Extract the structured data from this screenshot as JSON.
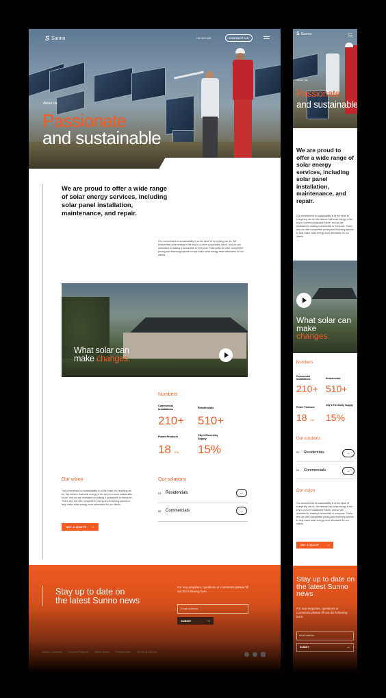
{
  "brand": {
    "name": "Sunno"
  },
  "header": {
    "phone": "+32 423 423",
    "contact_label": "CONTACT US"
  },
  "hero": {
    "eyebrow": "About Us",
    "title_line1": "Passionate",
    "title_line2": "and sustainable"
  },
  "intro": {
    "lead": "We are proud to offer a wide range of solar energy services, including solar panel installation, maintenance, and repair.",
    "body": "Our commitment to sustainability is at the heart of everything we do. We believe that solar energy is the key to a more sustainable future, and we are dedicated to making it accessible to everyone. That's why we offer competitive pricing and financing options to help make solar energy more affordable for our clients."
  },
  "video": {
    "caption_line1": "What solar can",
    "caption_prefix": "make",
    "caption_highlight": "changes."
  },
  "numbers": {
    "heading": "Numbers",
    "items": [
      {
        "label": "Commercial Installations",
        "value": "210+"
      },
      {
        "label": "Residencials",
        "value": "510+"
      },
      {
        "label": "Power Producer",
        "value": "18",
        "unit": "GW"
      },
      {
        "label": "City's Electricity Supply",
        "value": "15%"
      }
    ]
  },
  "vision": {
    "heading": "Our vision",
    "body": "Our commitment to sustainability is at the heart of everything we do. We believe that solar energy is the key to a more sustainable future, and we are dedicated to making it accessible to everyone. That's why we offer competitive pricing and financing options to help make solar energy more affordable for our clients.",
    "cta": "GET A QUOTE"
  },
  "solutions": {
    "heading": "Our solutions",
    "items": [
      {
        "num": "01",
        "label": "Residentials"
      },
      {
        "num": "02",
        "label": "Commercials"
      }
    ]
  },
  "newsletter": {
    "title_line1": "Stay up to date on",
    "title_line2": "the latest Sunno news",
    "note": "For any enquiries, questions or comments please fill out the following form.",
    "email_placeholder": "Email address",
    "submit": "SUBMIT"
  },
  "footer": {
    "links": [
      "About Company",
      "Current Projects",
      "Latest News",
      "Partnerships",
      "Terms of Service"
    ]
  },
  "icons": {
    "arrow": "arrow-right-icon",
    "play": "play-icon",
    "facebook": "facebook-icon",
    "twitter": "twitter-icon",
    "instagram": "instagram-icon"
  },
  "colors": {
    "accent": "#f25c22",
    "dark": "#111111"
  }
}
